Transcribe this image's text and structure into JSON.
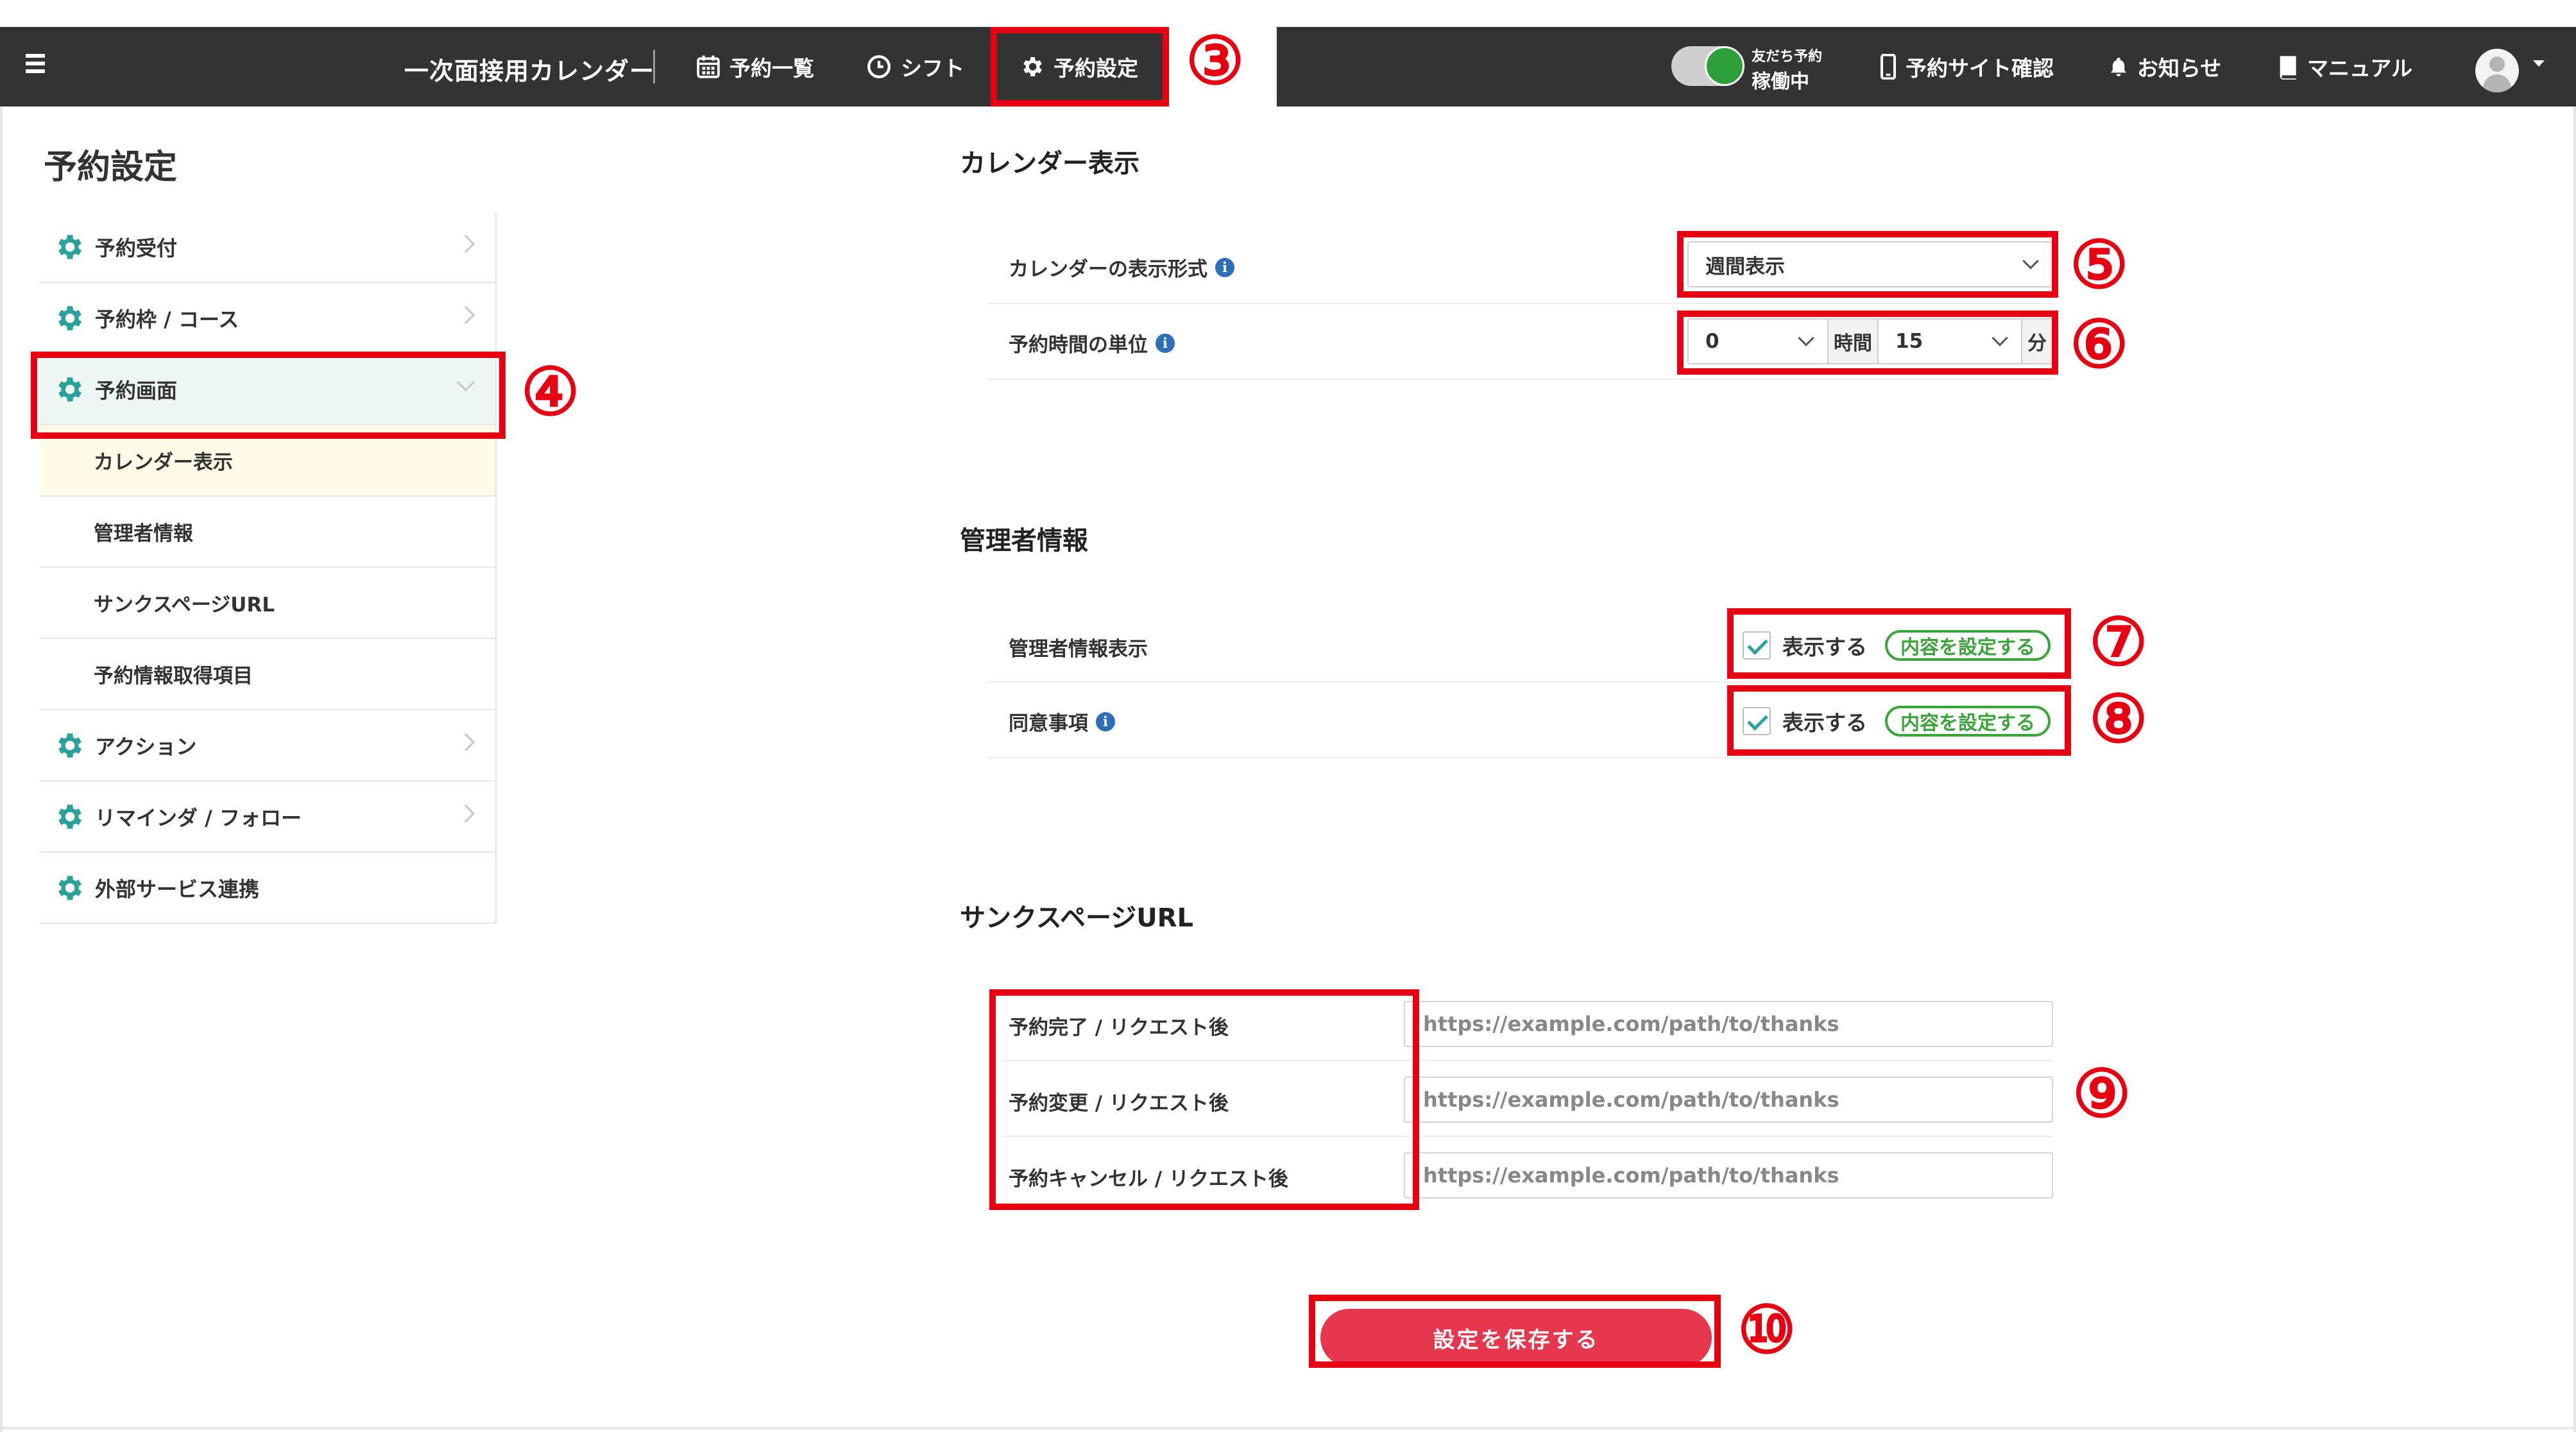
{
  "header": {
    "app_title": "一次面接用カレンダー",
    "nav": {
      "list": "予約一覧",
      "shift": "シフト",
      "settings": "予約設定"
    },
    "toggle": {
      "line1": "友だち予約",
      "line2": "稼働中",
      "state": "on"
    },
    "right_nav": {
      "site": "予約サイト確認",
      "notice": "お知らせ",
      "manual": "マニュアル"
    }
  },
  "callouts": {
    "n3": "③",
    "n4": "④",
    "n5": "⑤",
    "n6": "⑥",
    "n7": "⑦",
    "n8": "⑧",
    "n9": "⑨",
    "n10": "⑩"
  },
  "sidebar": {
    "title": "予約設定",
    "items": [
      {
        "label": "予約受付"
      },
      {
        "label": "予約枠 / コース"
      },
      {
        "label": "予約画面"
      },
      {
        "label": "カレンダー表示"
      },
      {
        "label": "管理者情報"
      },
      {
        "label": "サンクスページURL"
      },
      {
        "label": "予約情報取得項目"
      },
      {
        "label": "アクション"
      },
      {
        "label": "リマインダ / フォロー"
      },
      {
        "label": "外部サービス連携"
      }
    ]
  },
  "calendar_section": {
    "title": "カレンダー表示",
    "display_format_label": "カレンダーの表示形式",
    "display_format_value": "週間表示",
    "unit_label": "予約時間の単位",
    "hours_value": "0",
    "hours_unit": "時間",
    "minutes_value": "15",
    "minutes_unit": "分"
  },
  "admin_section": {
    "title": "管理者情報",
    "admin_display_label": "管理者情報表示",
    "consent_label": "同意事項",
    "show_label": "表示する",
    "configure_label": "内容を設定する"
  },
  "thanks_section": {
    "title": "サンクスページURL",
    "rows": [
      {
        "label": "予約完了 / リクエスト後",
        "placeholder": "https://example.com/path/to/thanks"
      },
      {
        "label": "予約変更 / リクエスト後",
        "placeholder": "https://example.com/path/to/thanks"
      },
      {
        "label": "予約キャンセル / リクエスト後",
        "placeholder": "https://example.com/path/to/thanks"
      }
    ]
  },
  "save_button": "設定を保存する",
  "colors": {
    "highlight": "#e60012",
    "topbar": "#333333",
    "accent_green": "#3ba43b",
    "gear_teal": "#2aa19a",
    "save": "#e5384f"
  }
}
